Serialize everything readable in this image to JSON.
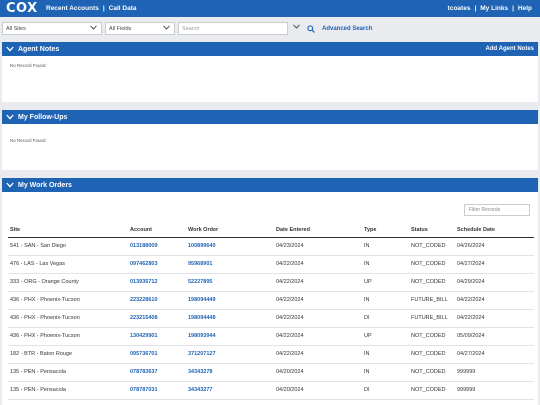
{
  "header": {
    "logo": "COX",
    "nav": [
      "Recent Accounts",
      "Call Data"
    ],
    "user": "tcoates",
    "links": [
      "My Links",
      "Help"
    ]
  },
  "filters": {
    "site": "All Sites",
    "field": "All Fields",
    "search_placeholder": "Search",
    "advanced_search": "Advanced Search"
  },
  "agent_notes": {
    "title": "Agent Notes",
    "action": "Add Agent Notes",
    "empty": "No Record Found"
  },
  "follow_ups": {
    "title": "My Follow-Ups",
    "empty": "No Record Found"
  },
  "work_orders": {
    "title": "My Work Orders",
    "filter_placeholder": "Filter Records",
    "columns": [
      "Site",
      "Account",
      "Work Order",
      "Date Entered",
      "Type",
      "Status",
      "Schedule Date"
    ],
    "rows": [
      [
        "541 - SAN - San Diego",
        "013188009",
        "100899640",
        "04/23/2024",
        "IN",
        "NOT_CODED",
        "04/26/2024"
      ],
      [
        "476 - LAS - Las Vegas",
        "097462803",
        "95968901",
        "04/22/2024",
        "IN",
        "NOT_CODED",
        "04/27/2024"
      ],
      [
        "333 - ORG - Orange County",
        "013935712",
        "52227895",
        "04/22/2024",
        "UP",
        "NOT_CODED",
        "04/29/2024"
      ],
      [
        "436 - PHX - Phoenix-Tucson",
        "223228610",
        "198094449",
        "04/22/2024",
        "IN",
        "FUTURE_BILL",
        "04/22/2024"
      ],
      [
        "436 - PHX - Phoenix-Tucson",
        "223215408",
        "198094448",
        "04/22/2024",
        "DI",
        "FUTURE_BILL",
        "04/22/2024"
      ],
      [
        "436 - PHX - Phoenix-Tucson",
        "130429901",
        "198093944",
        "04/22/2024",
        "UP",
        "NOT_CODED",
        "05/09/2024"
      ],
      [
        "182 - BTR - Baton Rouge",
        "095736701",
        "371207127",
        "04/22/2024",
        "IN",
        "NOT_CODED",
        "04/27/2024"
      ],
      [
        "135 - PEN - Pensacola",
        "078783637",
        "34343278",
        "04/20/2024",
        "IN",
        "NOT_CODED",
        "999999"
      ],
      [
        "135 - PEN - Pensacola",
        "078787031",
        "34343277",
        "04/20/2024",
        "DI",
        "NOT_CODED",
        "999999"
      ]
    ]
  },
  "colors": {
    "brand_blue": "#1e63b4",
    "page_bg": "#e9ebee"
  },
  "icons": {
    "panel_toggle": "chevron-down-icon",
    "search": "search-icon"
  }
}
